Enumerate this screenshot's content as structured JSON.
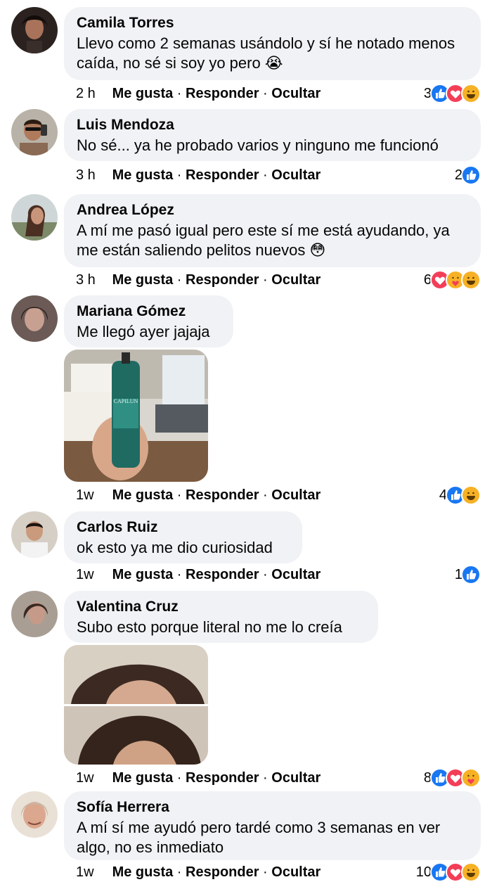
{
  "actions": {
    "like": "Me gusta",
    "reply": "Responder",
    "hide": "Ocultar"
  },
  "colors": {
    "bubble": "#f0f2f5",
    "like": "#1877f2",
    "love": "#f33e58",
    "haha": "#f7b125"
  },
  "comments": [
    {
      "name": "Camila Torres",
      "text": "Llevo como 2 semanas usándolo y sí he notado menos caída, no sé si soy yo pero 😭",
      "time": "2 h",
      "count": "3",
      "reactions": [
        "like-icon",
        "love-icon",
        "haha-icon"
      ]
    },
    {
      "name": "Luis Mendoza",
      "text": "No sé... ya he probado varios y ninguno me funcionó",
      "time": "3 h",
      "count": "2",
      "reactions": [
        "like-icon"
      ]
    },
    {
      "name": "Andrea López",
      "text": "A mí me pasó igual pero este sí me está ayudando, ya me están saliendo pelitos nuevos 😳",
      "time": "3 h",
      "count": "6",
      "reactions": [
        "love-icon",
        "care-icon",
        "haha-icon"
      ]
    },
    {
      "name": "Mariana Gómez",
      "text": "Me llegó ayer jajaja",
      "time": "1w",
      "count": "4",
      "reactions": [
        "like-icon",
        "haha-icon"
      ],
      "photo_label": "CAPILUN"
    },
    {
      "name": "Carlos Ruiz",
      "text": "ok esto ya me dio curiosidad",
      "time": "1w",
      "count": "1",
      "reactions": [
        "like-icon"
      ]
    },
    {
      "name": "Valentina Cruz",
      "text": "Subo esto porque literal no me lo creía",
      "time": "1w",
      "count": "8",
      "reactions": [
        "like-icon",
        "love-icon",
        "care-icon"
      ]
    },
    {
      "name": "Sofía Herrera",
      "text": "A mí sí me ayudó pero tardé como 3 semanas en ver algo, no es inmediato",
      "time": "1w",
      "count": "10",
      "reactions": [
        "like-icon",
        "love-icon",
        "haha-icon"
      ]
    }
  ]
}
